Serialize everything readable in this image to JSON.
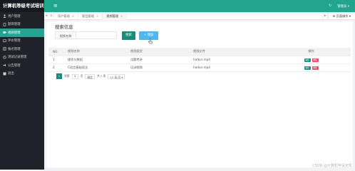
{
  "app": {
    "title": "计算机等级考试培训"
  },
  "sidebar": {
    "items": [
      {
        "label": "用户管理",
        "icon": "user-icon"
      },
      {
        "label": "题目管理",
        "icon": "document-icon"
      },
      {
        "label": "视频管理",
        "icon": "video-icon",
        "active": true
      },
      {
        "label": "评价管理",
        "icon": "comment-icon"
      },
      {
        "label": "报名管理",
        "icon": "form-icon"
      },
      {
        "label": "测试记录管理",
        "icon": "record-icon"
      },
      {
        "label": "公告管理",
        "icon": "notice-icon"
      },
      {
        "label": "退出",
        "icon": "logout-icon"
      }
    ]
  },
  "topbar": {
    "user": "管理员 ▾",
    "refresh_icon": "refresh-icon"
  },
  "tabs": {
    "items": [
      {
        "label": "用户管理"
      },
      {
        "label": "题目管理"
      },
      {
        "label": "视频管理",
        "active": true
      }
    ],
    "page_ops": "⚙ 页面操作 ▾",
    "close_glyph": "×",
    "prev": "◂",
    "next": "▸"
  },
  "search": {
    "title": "搜索信息",
    "label": "视频名称",
    "value": "",
    "search_button": "搜索",
    "add_button": "+ 增加"
  },
  "table": {
    "headers": [
      "NO",
      "视频名称",
      "视频类型",
      "视频文件",
      "操作"
    ],
    "rows": [
      [
        "1",
        "操作与数组",
        "试题考讲",
        "hadun.mp4"
      ],
      [
        "2",
        "C语言基础语法",
        "培训视频",
        "hadun.mp4"
      ]
    ],
    "edit_label": "编辑",
    "delete_label": "删除"
  },
  "pagination": {
    "current": "1",
    "goto_label": "到第",
    "page_input": "1",
    "page_unit": "页",
    "confirm": "确定",
    "total": "共 2 条",
    "per_page": "10 条/页 ▾"
  },
  "watermark": "CSDN @计算机毕设无忧"
}
